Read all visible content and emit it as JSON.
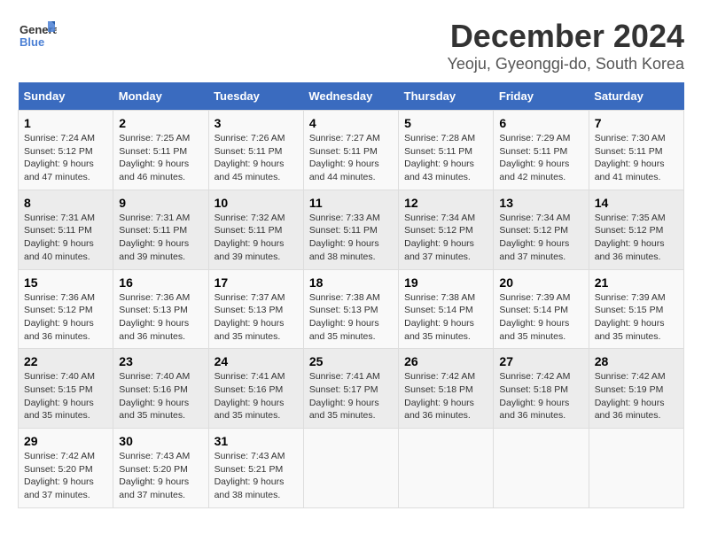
{
  "logo": {
    "line1": "General",
    "line2": "Blue"
  },
  "title": "December 2024",
  "subtitle": "Yeoju, Gyeonggi-do, South Korea",
  "days_of_week": [
    "Sunday",
    "Monday",
    "Tuesday",
    "Wednesday",
    "Thursday",
    "Friday",
    "Saturday"
  ],
  "weeks": [
    [
      {
        "day": 1,
        "sunrise": "7:24 AM",
        "sunset": "5:12 PM",
        "daylight": "9 hours and 47 minutes."
      },
      {
        "day": 2,
        "sunrise": "7:25 AM",
        "sunset": "5:11 PM",
        "daylight": "9 hours and 46 minutes."
      },
      {
        "day": 3,
        "sunrise": "7:26 AM",
        "sunset": "5:11 PM",
        "daylight": "9 hours and 45 minutes."
      },
      {
        "day": 4,
        "sunrise": "7:27 AM",
        "sunset": "5:11 PM",
        "daylight": "9 hours and 44 minutes."
      },
      {
        "day": 5,
        "sunrise": "7:28 AM",
        "sunset": "5:11 PM",
        "daylight": "9 hours and 43 minutes."
      },
      {
        "day": 6,
        "sunrise": "7:29 AM",
        "sunset": "5:11 PM",
        "daylight": "9 hours and 42 minutes."
      },
      {
        "day": 7,
        "sunrise": "7:30 AM",
        "sunset": "5:11 PM",
        "daylight": "9 hours and 41 minutes."
      }
    ],
    [
      {
        "day": 8,
        "sunrise": "7:31 AM",
        "sunset": "5:11 PM",
        "daylight": "9 hours and 40 minutes."
      },
      {
        "day": 9,
        "sunrise": "7:31 AM",
        "sunset": "5:11 PM",
        "daylight": "9 hours and 39 minutes."
      },
      {
        "day": 10,
        "sunrise": "7:32 AM",
        "sunset": "5:11 PM",
        "daylight": "9 hours and 39 minutes."
      },
      {
        "day": 11,
        "sunrise": "7:33 AM",
        "sunset": "5:11 PM",
        "daylight": "9 hours and 38 minutes."
      },
      {
        "day": 12,
        "sunrise": "7:34 AM",
        "sunset": "5:12 PM",
        "daylight": "9 hours and 37 minutes."
      },
      {
        "day": 13,
        "sunrise": "7:34 AM",
        "sunset": "5:12 PM",
        "daylight": "9 hours and 37 minutes."
      },
      {
        "day": 14,
        "sunrise": "7:35 AM",
        "sunset": "5:12 PM",
        "daylight": "9 hours and 36 minutes."
      }
    ],
    [
      {
        "day": 15,
        "sunrise": "7:36 AM",
        "sunset": "5:12 PM",
        "daylight": "9 hours and 36 minutes."
      },
      {
        "day": 16,
        "sunrise": "7:36 AM",
        "sunset": "5:13 PM",
        "daylight": "9 hours and 36 minutes."
      },
      {
        "day": 17,
        "sunrise": "7:37 AM",
        "sunset": "5:13 PM",
        "daylight": "9 hours and 35 minutes."
      },
      {
        "day": 18,
        "sunrise": "7:38 AM",
        "sunset": "5:13 PM",
        "daylight": "9 hours and 35 minutes."
      },
      {
        "day": 19,
        "sunrise": "7:38 AM",
        "sunset": "5:14 PM",
        "daylight": "9 hours and 35 minutes."
      },
      {
        "day": 20,
        "sunrise": "7:39 AM",
        "sunset": "5:14 PM",
        "daylight": "9 hours and 35 minutes."
      },
      {
        "day": 21,
        "sunrise": "7:39 AM",
        "sunset": "5:15 PM",
        "daylight": "9 hours and 35 minutes."
      }
    ],
    [
      {
        "day": 22,
        "sunrise": "7:40 AM",
        "sunset": "5:15 PM",
        "daylight": "9 hours and 35 minutes."
      },
      {
        "day": 23,
        "sunrise": "7:40 AM",
        "sunset": "5:16 PM",
        "daylight": "9 hours and 35 minutes."
      },
      {
        "day": 24,
        "sunrise": "7:41 AM",
        "sunset": "5:16 PM",
        "daylight": "9 hours and 35 minutes."
      },
      {
        "day": 25,
        "sunrise": "7:41 AM",
        "sunset": "5:17 PM",
        "daylight": "9 hours and 35 minutes."
      },
      {
        "day": 26,
        "sunrise": "7:42 AM",
        "sunset": "5:18 PM",
        "daylight": "9 hours and 36 minutes."
      },
      {
        "day": 27,
        "sunrise": "7:42 AM",
        "sunset": "5:18 PM",
        "daylight": "9 hours and 36 minutes."
      },
      {
        "day": 28,
        "sunrise": "7:42 AM",
        "sunset": "5:19 PM",
        "daylight": "9 hours and 36 minutes."
      }
    ],
    [
      {
        "day": 29,
        "sunrise": "7:42 AM",
        "sunset": "5:20 PM",
        "daylight": "9 hours and 37 minutes."
      },
      {
        "day": 30,
        "sunrise": "7:43 AM",
        "sunset": "5:20 PM",
        "daylight": "9 hours and 37 minutes."
      },
      {
        "day": 31,
        "sunrise": "7:43 AM",
        "sunset": "5:21 PM",
        "daylight": "9 hours and 38 minutes."
      },
      null,
      null,
      null,
      null
    ]
  ],
  "labels": {
    "sunrise": "Sunrise:",
    "sunset": "Sunset:",
    "daylight": "Daylight:"
  }
}
